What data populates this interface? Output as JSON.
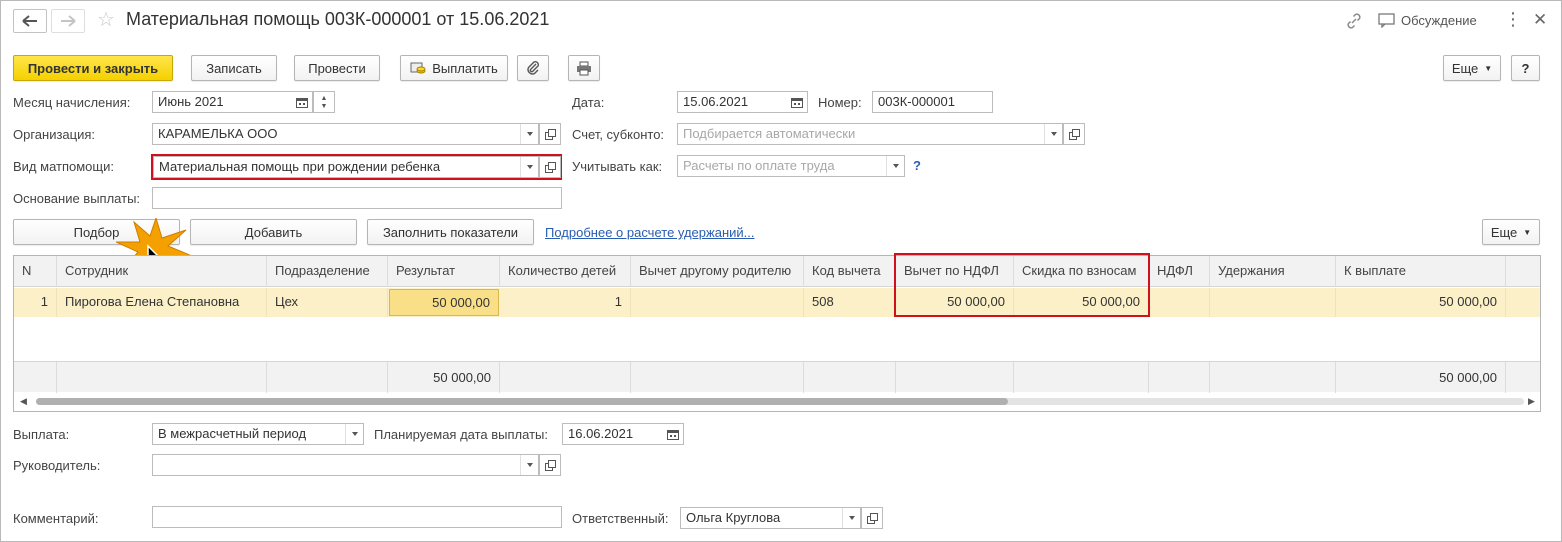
{
  "window": {
    "title": "Материальная помощь 003К-000001 от 15.06.2021",
    "discussion_label": "Обсуждение"
  },
  "toolbar": {
    "post_close": "Провести и закрыть",
    "save": "Записать",
    "post": "Провести",
    "pay": "Выплатить",
    "more": "Еще",
    "help": "?"
  },
  "form": {
    "month_label": "Месяц начисления:",
    "month_value": "Июнь 2021",
    "date_label": "Дата:",
    "date_value": "15.06.2021",
    "number_label": "Номер:",
    "number_value": "003К-000001",
    "org_label": "Организация:",
    "org_value": "КАРАМЕЛЬКА ООО",
    "account_label": "Счет, субконто:",
    "account_placeholder": "Подбирается автоматически",
    "aid_type_label": "Вид матпомощи:",
    "aid_type_value": "Материальная помощь при рождении ребенка",
    "account_as_label": "Учитывать как:",
    "account_as_placeholder": "Расчеты по оплате труда",
    "help_q": "?",
    "basis_label": "Основание выплаты:",
    "basis_value": ""
  },
  "table_toolbar": {
    "select": "Подбор",
    "add": "Добавить",
    "fill": "Заполнить показатели",
    "details_link": "Подробнее о расчете удержаний...",
    "more": "Еще"
  },
  "table": {
    "columns": [
      "N",
      "Сотрудник",
      "Подразделение",
      "Результат",
      "Количество детей",
      "Вычет другому родителю",
      "Код вычета",
      "Вычет по НДФЛ",
      "Скидка по взносам",
      "НДФЛ",
      "Удержания",
      "К выплате"
    ],
    "rows": [
      [
        "1",
        "Пирогова Елена Степановна",
        "Цех",
        "50 000,00",
        "1",
        "",
        "508",
        "50 000,00",
        "50 000,00",
        "",
        "",
        "50 000,00"
      ]
    ],
    "totals": {
      "result": "50 000,00",
      "to_pay": "50 000,00"
    }
  },
  "bottom": {
    "payment_label": "Выплата:",
    "payment_value": "В межрасчетный период",
    "plan_date_label": "Планируемая дата выплаты:",
    "plan_date_value": "16.06.2021",
    "manager_label": "Руководитель:",
    "manager_value": "",
    "comment_label": "Комментарий:",
    "comment_value": "",
    "responsible_label": "Ответственный:",
    "responsible_value": "Ольга Круглова"
  },
  "colors": {
    "primary_button": "#f5d100",
    "highlight_row": "#fbf0c8",
    "annotation_red": "#d0101a",
    "link": "#2a5db0"
  }
}
